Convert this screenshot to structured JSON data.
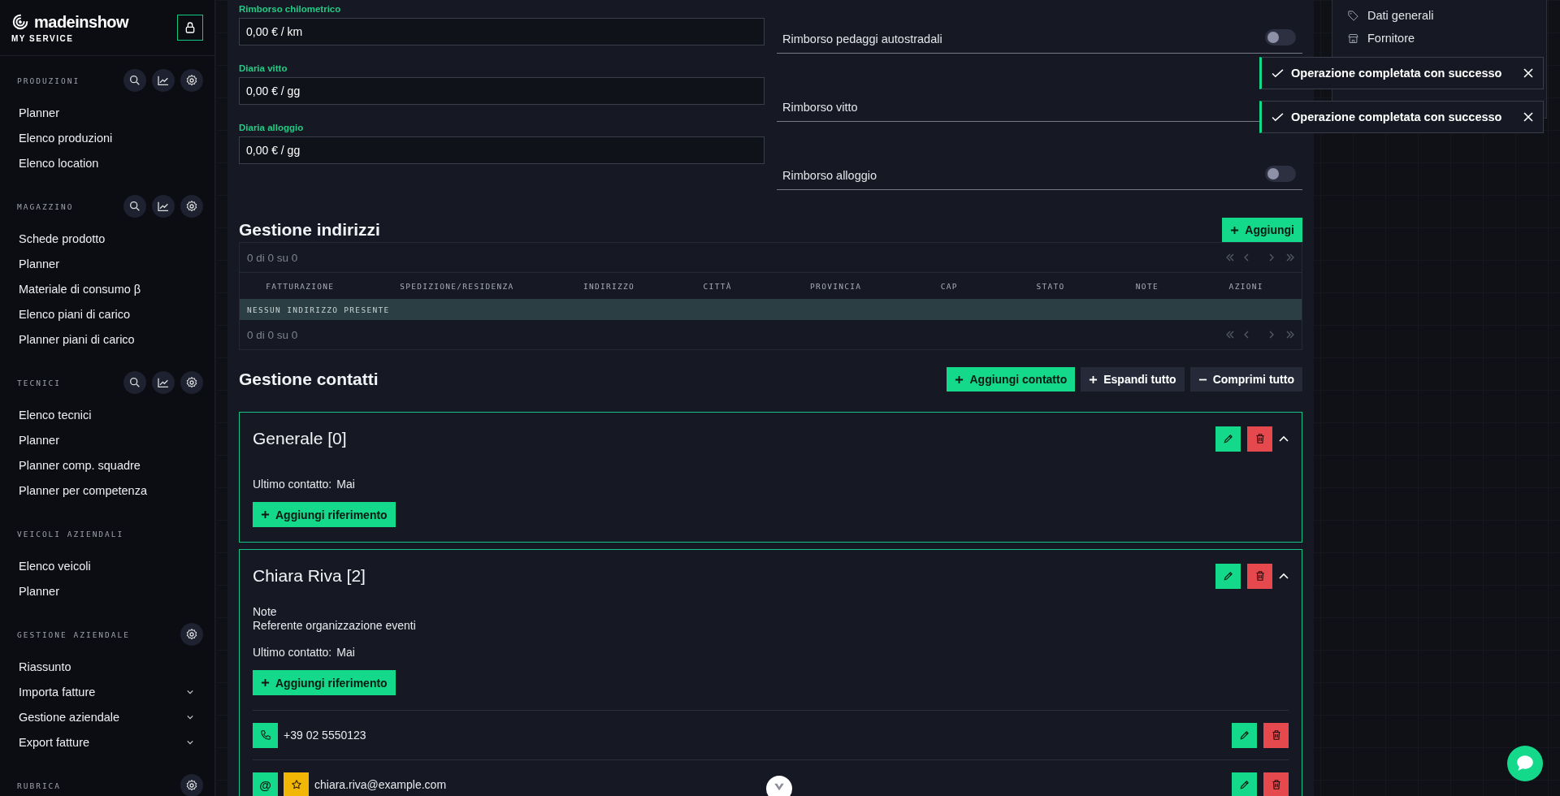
{
  "sidebar": {
    "logo": "madeinshow",
    "subtitle": "MY SERVICE",
    "sections": [
      {
        "title": "PRODUZIONI",
        "tools": [
          {
            "kind": "search"
          },
          {
            "kind": "chart"
          },
          {
            "kind": "settings"
          }
        ],
        "items": [
          {
            "label": "Planner",
            "expandable": false
          },
          {
            "label": "Elenco produzioni",
            "expandable": false
          },
          {
            "label": "Elenco location",
            "expandable": false
          }
        ]
      },
      {
        "title": "MAGAZZINO",
        "tools": [
          {
            "kind": "search"
          },
          {
            "kind": "chart"
          },
          {
            "kind": "settings"
          }
        ],
        "items": [
          {
            "label": "Schede prodotto",
            "expandable": false
          },
          {
            "label": "Planner",
            "expandable": false
          },
          {
            "label": "Materiale di consumo β",
            "expandable": false
          },
          {
            "label": "Elenco piani di carico",
            "expandable": false
          },
          {
            "label": "Planner piani di carico",
            "expandable": false
          }
        ]
      },
      {
        "title": "TECNICI",
        "tools": [
          {
            "kind": "search"
          },
          {
            "kind": "chart"
          },
          {
            "kind": "settings"
          }
        ],
        "items": [
          {
            "label": "Elenco tecnici",
            "expandable": false
          },
          {
            "label": "Planner",
            "expandable": false
          },
          {
            "label": "Planner comp. squadre",
            "expandable": false
          },
          {
            "label": "Planner per competenza",
            "expandable": false
          }
        ]
      },
      {
        "title": "VEICOLI AZIENDALI",
        "items": [
          {
            "label": "Elenco veicoli",
            "expandable": false
          },
          {
            "label": "Planner",
            "expandable": false
          }
        ]
      },
      {
        "title": "GESTIONE AZIENDALE",
        "tools": [
          {
            "kind": "settings"
          }
        ],
        "items": [
          {
            "label": "Riassunto",
            "expandable": false
          },
          {
            "label": "Importa fatture",
            "expandable": true
          },
          {
            "label": "Gestione aziendale",
            "expandable": true
          },
          {
            "label": "Export fatture",
            "expandable": true
          }
        ]
      },
      {
        "title": "RUBRICA",
        "tools": [
          {
            "kind": "settings"
          }
        ]
      }
    ]
  },
  "fields": [
    {
      "label": "Rimborso chilometrico",
      "value": "0,00 € / km"
    },
    {
      "label": "Diaria vitto",
      "value": "0,00 € / gg"
    },
    {
      "label": "Diaria alloggio",
      "value": "0,00 € / gg"
    }
  ],
  "toggles": [
    {
      "label": "Rimborso pedaggi autostradali",
      "on": false
    },
    {
      "label": "Rimborso vitto"
    },
    {
      "label": "Rimborso alloggio",
      "on": false
    }
  ],
  "addresses": {
    "title": "Gestione indirizzi",
    "add_button": "Aggiungi",
    "pager_top": "0 di 0 su 0",
    "columns": [
      "FATTURAZIONE",
      "SPEDIZIONE/RESIDENZA",
      "INDIRIZZO",
      "CITTÀ",
      "PROVINCIA",
      "CAP",
      "STATO",
      "NOTE",
      "AZIONI"
    ],
    "empty_message": "NESSUN INDIRIZZO PRESENTE",
    "pager_bottom": "0 di 0 su 0"
  },
  "contacts": {
    "title": "Gestione contatti",
    "buttons": [
      {
        "kind": "add",
        "label": "Aggiungi contatto"
      },
      {
        "kind": "expand",
        "label": "Espandi tutto"
      },
      {
        "kind": "collapse",
        "label": "Comprimi tutto"
      }
    ],
    "cards": [
      {
        "title": "Generale [0]",
        "expanded": true,
        "last_contact_label": "Ultimo contatto:",
        "last_contact": "Mai",
        "add_reference": "Aggiungi riferimento"
      },
      {
        "title": "Chiara Riva [2]",
        "expanded": true,
        "note_label": "Note",
        "note": "Referente organizzazione eventi",
        "last_contact_label": "Ultimo contatto:",
        "last_contact": "Mai",
        "add_reference": "Aggiungi riferimento",
        "references": [
          {
            "kind": "phone",
            "value": "+39 02 5550123",
            "favorite": false
          },
          {
            "kind": "email",
            "symbol": "@",
            "value": "chiara.riva@example.com",
            "favorite": true
          }
        ]
      }
    ]
  },
  "menu": [
    {
      "kind": "tag",
      "label": "Dati generali"
    },
    {
      "kind": "store",
      "label": "Fornitore"
    }
  ],
  "toasts": [
    {
      "message": "Operazione completata con successo"
    },
    {
      "message": "Operazione completata con successo"
    }
  ]
}
